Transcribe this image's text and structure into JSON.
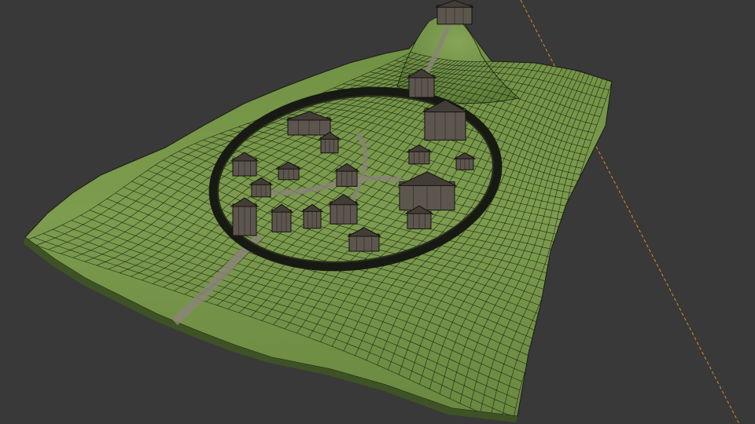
{
  "viewport": {
    "background": "#393939",
    "kind": "3d-wireframe-viewport"
  },
  "scene": {
    "subject": "motte-and-bailey-village",
    "terrain_color": "#7a9a4c",
    "terrain_dark": "#5b7a34",
    "wire_color": "#141810",
    "palisade_color": "#171a12",
    "road_color": "#8a8575",
    "building_color": "#5d564e",
    "building_roof": "#433d37",
    "axis_color": "#e08a1e",
    "buildings": [
      "keep",
      "manor",
      "hall",
      "longhouse-1",
      "longhouse-2",
      "hut-1",
      "hut-2",
      "hut-3",
      "hut-4",
      "hut-5",
      "hut-6",
      "hut-7",
      "hut-8",
      "hut-9",
      "hut-10",
      "hut-11",
      "hut-12",
      "gatehouse"
    ]
  }
}
